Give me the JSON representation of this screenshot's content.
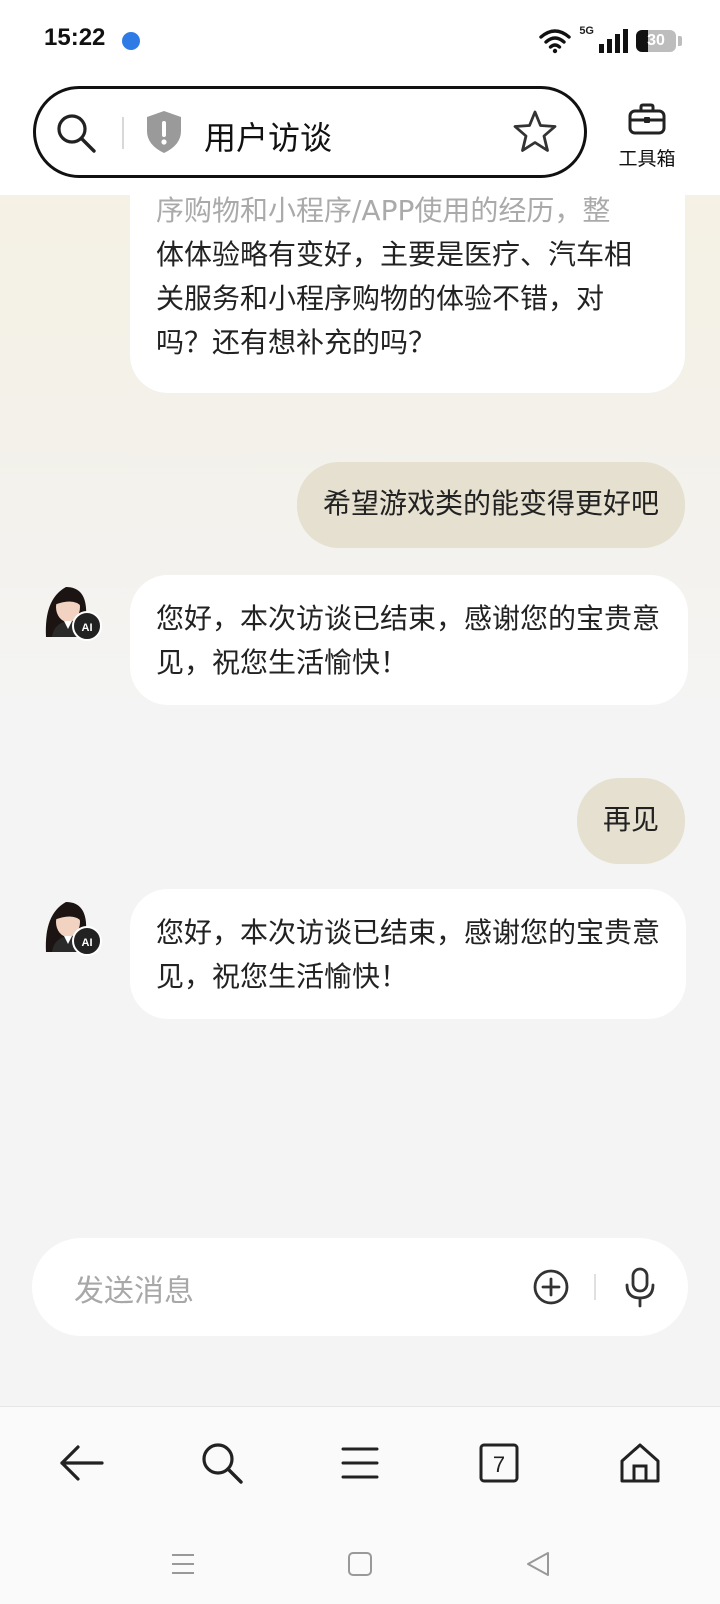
{
  "status_bar": {
    "time": "15:22",
    "network": "5G",
    "battery": "30",
    "battery_level": 0.3
  },
  "header": {
    "search_text": "用户访谈",
    "toolbox_label": "工具箱"
  },
  "chat": {
    "messages": [
      {
        "role": "ai",
        "partial_text": "序购物和小程序/APP使用的经历，整",
        "text": "体体验略有变好，主要是医疗、汽车相关服务和小程序购物的体验不错，对吗？还有想补充的吗？"
      },
      {
        "role": "user",
        "text": "希望游戏类的能变得更好吧"
      },
      {
        "role": "ai",
        "avatar_badge": "AI",
        "text": "您好，本次访谈已结束，感谢您的宝贵意见，祝您生活愉快！"
      },
      {
        "role": "user",
        "text": "再见"
      },
      {
        "role": "ai",
        "avatar_badge": "AI",
        "text": "您好，本次访谈已结束，感谢您的宝贵意见，祝您生活愉快！"
      }
    ]
  },
  "input": {
    "placeholder": "发送消息"
  },
  "bottom_nav": {
    "tabs_count": "7",
    "icons": [
      "back-arrow-icon",
      "search-icon",
      "menu-icon",
      "tabs-icon",
      "home-icon"
    ]
  }
}
